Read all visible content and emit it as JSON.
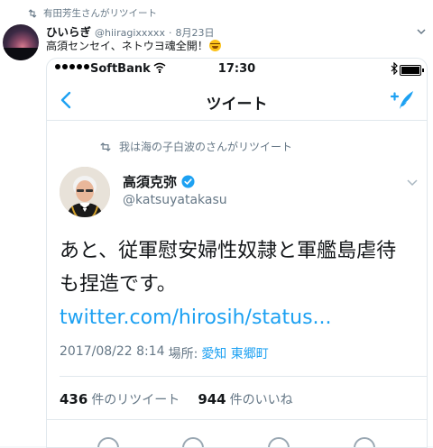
{
  "outer_tweet": {
    "retweet_notice": "有田芳生さんがリツイート",
    "author_name": "ひいらぎ",
    "author_handle": "@hiiragixxxxx",
    "separator": "·",
    "date": "8月23日",
    "text": "高須センセイ、ネトウヨ魂全開！",
    "emoji": "grinning-sweat-emoji"
  },
  "phone_status": {
    "carrier": "SoftBank",
    "time": "17:30"
  },
  "screen": {
    "title": "ツイート"
  },
  "inner_tweet": {
    "retweet_notice": "我は海の子白波のさんがリツイート",
    "author_name": "高須克弥",
    "author_handle": "@katsuyatakasu",
    "body_text": "あと、従軍慰安婦性奴隷と軍艦島虐待も捏造です。 ",
    "link_text": "twitter.com/hirosih/status...",
    "timestamp": "2017/08/22 8:14",
    "location_label": "場所:",
    "location_value": "愛知 東郷町",
    "retweet_count": "436",
    "retweet_suffix": "件のリツイート",
    "like_count": "944",
    "like_suffix": "件のいいね"
  },
  "colors": {
    "accent": "#1da1f2",
    "muted": "#657786",
    "border": "#e1e8ed"
  }
}
